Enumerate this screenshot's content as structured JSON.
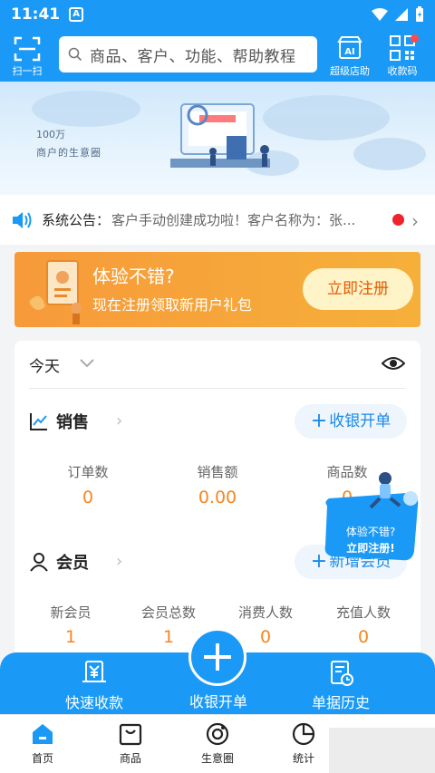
{
  "status_bar": {
    "time": "11:41",
    "badge": "A"
  },
  "header": {
    "scan_label": "扫一扫",
    "search_placeholder": "商品、客户、功能、帮助教程",
    "store_label": "超级店助",
    "qr_label": "收款码"
  },
  "banner": {
    "line1": "100万",
    "line2": "商户的生意圈"
  },
  "notice": {
    "label": "系统公告：",
    "text": "客户手动创建成功啦！客户名称为：张..."
  },
  "promo": {
    "title": "体验不错?",
    "subtitle": "现在注册领取新用户礼包",
    "button": "立即注册"
  },
  "dashboard": {
    "period": "今天",
    "sales": {
      "title": "销售",
      "action": "收银开单",
      "metrics": [
        {
          "label": "订单数",
          "value": "0"
        },
        {
          "label": "销售额",
          "value": "0.00"
        },
        {
          "label": "商品数",
          "value": "0"
        }
      ]
    },
    "members": {
      "title": "会员",
      "action": "新增会员",
      "metrics": [
        {
          "label": "新会员",
          "value": "1"
        },
        {
          "label": "会员总数",
          "value": "1"
        },
        {
          "label": "消费人数",
          "value": "0"
        },
        {
          "label": "充值人数",
          "value": "0"
        }
      ]
    }
  },
  "float_promo": {
    "line1": "体验不错?",
    "line2": "立即注册!"
  },
  "quick_actions": {
    "left": "快速收款",
    "center": "收银开单",
    "right": "单据历史"
  },
  "bottom_nav": {
    "items": [
      {
        "label": "首页"
      },
      {
        "label": "商品"
      },
      {
        "label": "生意圈"
      },
      {
        "label": "统计"
      }
    ]
  },
  "colors": {
    "brand": "#1a9af6",
    "accent_orange": "#f5861f",
    "promo_orange": "#f79a3a"
  }
}
